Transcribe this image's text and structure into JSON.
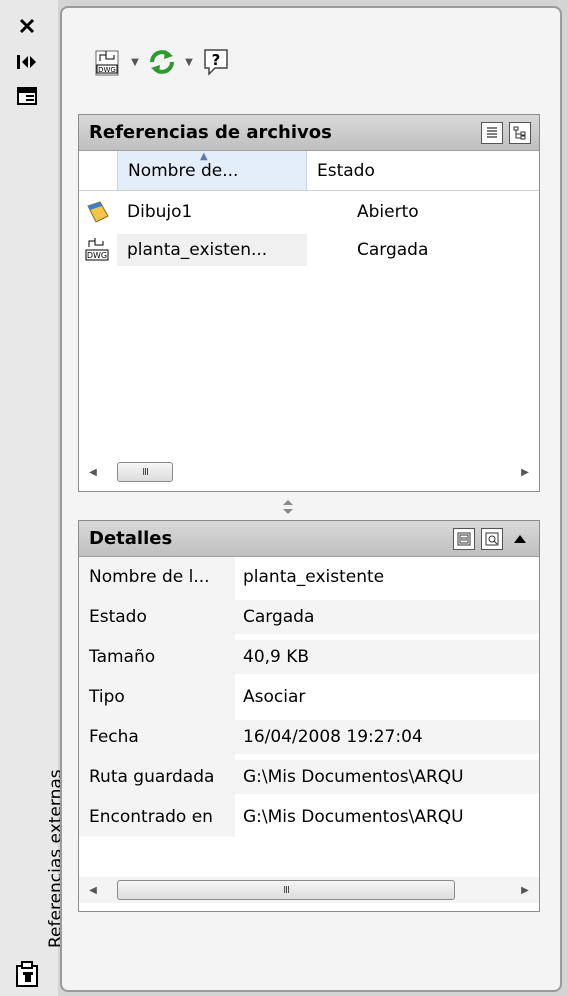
{
  "palette": {
    "vertical_title": "Referencias externas",
    "controls": {
      "close_icon": "×",
      "autohide_icon": "auto-hide-icon",
      "properties_icon": "properties-icon"
    }
  },
  "toolbar": {
    "attach_dwg": "attach-dwg-icon",
    "refresh": "refresh-icon",
    "help": "help-icon"
  },
  "file_references": {
    "title": "Referencias de archivos",
    "columns": {
      "name": "Nombre de...",
      "state": "Estado"
    },
    "rows": [
      {
        "name": "Dibujo1",
        "state": "Abierto",
        "icon": "drawing-icon"
      },
      {
        "name": "planta_existen...",
        "state": "Cargada",
        "icon": "dwg-icon"
      }
    ],
    "scroll_thumb": "III"
  },
  "details": {
    "title": "Detalles",
    "rows": [
      {
        "label": "Nombre de l...",
        "value": "planta_existente"
      },
      {
        "label": "Estado",
        "value": "Cargada"
      },
      {
        "label": "Tamaño",
        "value": "40,9 KB"
      },
      {
        "label": "Tipo",
        "value": "Asociar"
      },
      {
        "label": "Fecha",
        "value": "16/04/2008 19:27:04"
      },
      {
        "label": "Ruta guardada",
        "value": "G:\\Mis Documentos\\ARQU"
      },
      {
        "label": "Encontrado en",
        "value": "G:\\Mis Documentos\\ARQU"
      }
    ],
    "scroll_thumb": "III"
  }
}
